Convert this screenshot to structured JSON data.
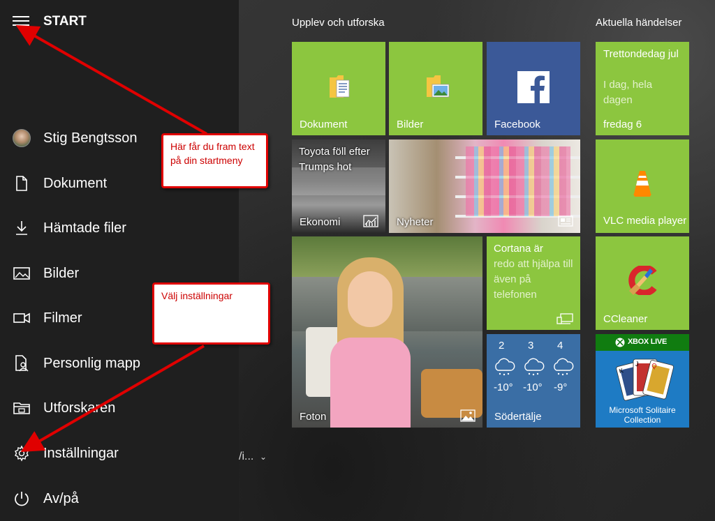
{
  "start": {
    "title": "START"
  },
  "sidebar": {
    "user": "Stig Bengtsson",
    "items": [
      {
        "label": "Dokument"
      },
      {
        "label": "Hämtade filer"
      },
      {
        "label": "Bilder"
      },
      {
        "label": "Filmer"
      },
      {
        "label": "Personlig mapp"
      },
      {
        "label": "Utforskaren"
      },
      {
        "label": "Inställningar"
      },
      {
        "label": "Av/på"
      }
    ],
    "language_partial": "/i..."
  },
  "groups": {
    "left": "Upplev och utforska",
    "right": "Aktuella händelser"
  },
  "tiles": {
    "dokument": "Dokument",
    "bilder": "Bilder",
    "facebook": "Facebook",
    "news_ekonomi_headline": "Toyota föll efter Trumps hot",
    "news_ekonomi_label": "Ekonomi",
    "nyheter": "Nyheter",
    "foton": "Foton",
    "cortana_title": "Cortana är",
    "cortana_text": "redo att hjälpa till även på telefonen",
    "weather": {
      "days": [
        "2",
        "3",
        "4"
      ],
      "temps": [
        "-10°",
        "-10°",
        "-9°"
      ],
      "city": "Södertälje"
    },
    "calendar": {
      "event": "Trettondedag jul",
      "when": "I dag, hela dagen",
      "date": "fredag 6"
    },
    "vlc": "VLC media player",
    "ccleaner": "CCleaner",
    "xbox_brand": "XBOX LIVE",
    "solitaire": "Microsoft Solitaire Collection"
  },
  "callouts": {
    "top": "Här får du fram text på din startmeny",
    "bottom": "Välj inställningar"
  },
  "colors": {
    "tile_green": "#8cc63f",
    "facebook": "#3b5998",
    "weather": "#3a6ea5",
    "annotation_red": "#e00000"
  }
}
